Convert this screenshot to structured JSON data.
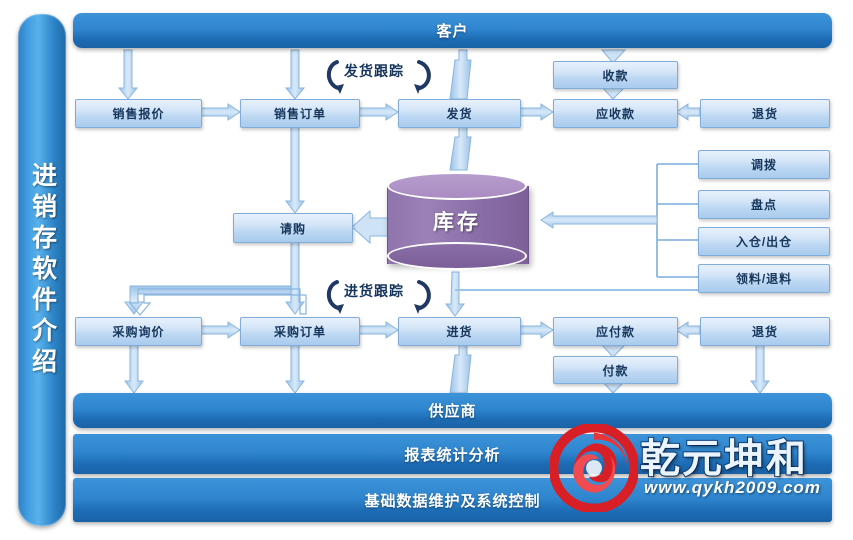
{
  "sidebar": {
    "title": "进销存软件介绍"
  },
  "bands": {
    "customer": "客户",
    "supplier": "供应商",
    "reports": "报表统计分析",
    "foundation": "基础数据维护及系统控制"
  },
  "inventory": {
    "label": "库存"
  },
  "tracking": {
    "shipping": "发货跟踪",
    "purchasing": "进货跟踪"
  },
  "sales_flow": [
    {
      "label": "销售报价"
    },
    {
      "label": "销售订单"
    },
    {
      "label": "发货"
    }
  ],
  "receivables": {
    "collection": "收款",
    "receivable": "应收款",
    "sales_return": "退货"
  },
  "requisition": {
    "label": "请购"
  },
  "warehouse_ops": [
    {
      "label": "调拨"
    },
    {
      "label": "盘点"
    },
    {
      "label": "入仓/出仓"
    },
    {
      "label": "领料/退料"
    }
  ],
  "purchase_flow": [
    {
      "label": "采购询价"
    },
    {
      "label": "采购订单"
    },
    {
      "label": "进货"
    }
  ],
  "payables": {
    "payable": "应付款",
    "payment": "付款",
    "purchase_return": "退货"
  },
  "logo": {
    "brand": "乾元坤和",
    "url": "www.qykh2009.com"
  },
  "colors": {
    "band_blue": "#2f86cf",
    "node_blue": "#bcd7f2",
    "node_border": "#7facd8",
    "connector": "#9cc3e8",
    "inventory_purple": "#8b6fa9",
    "logo_red": "#d81f26",
    "text_navy": "#16365c"
  }
}
